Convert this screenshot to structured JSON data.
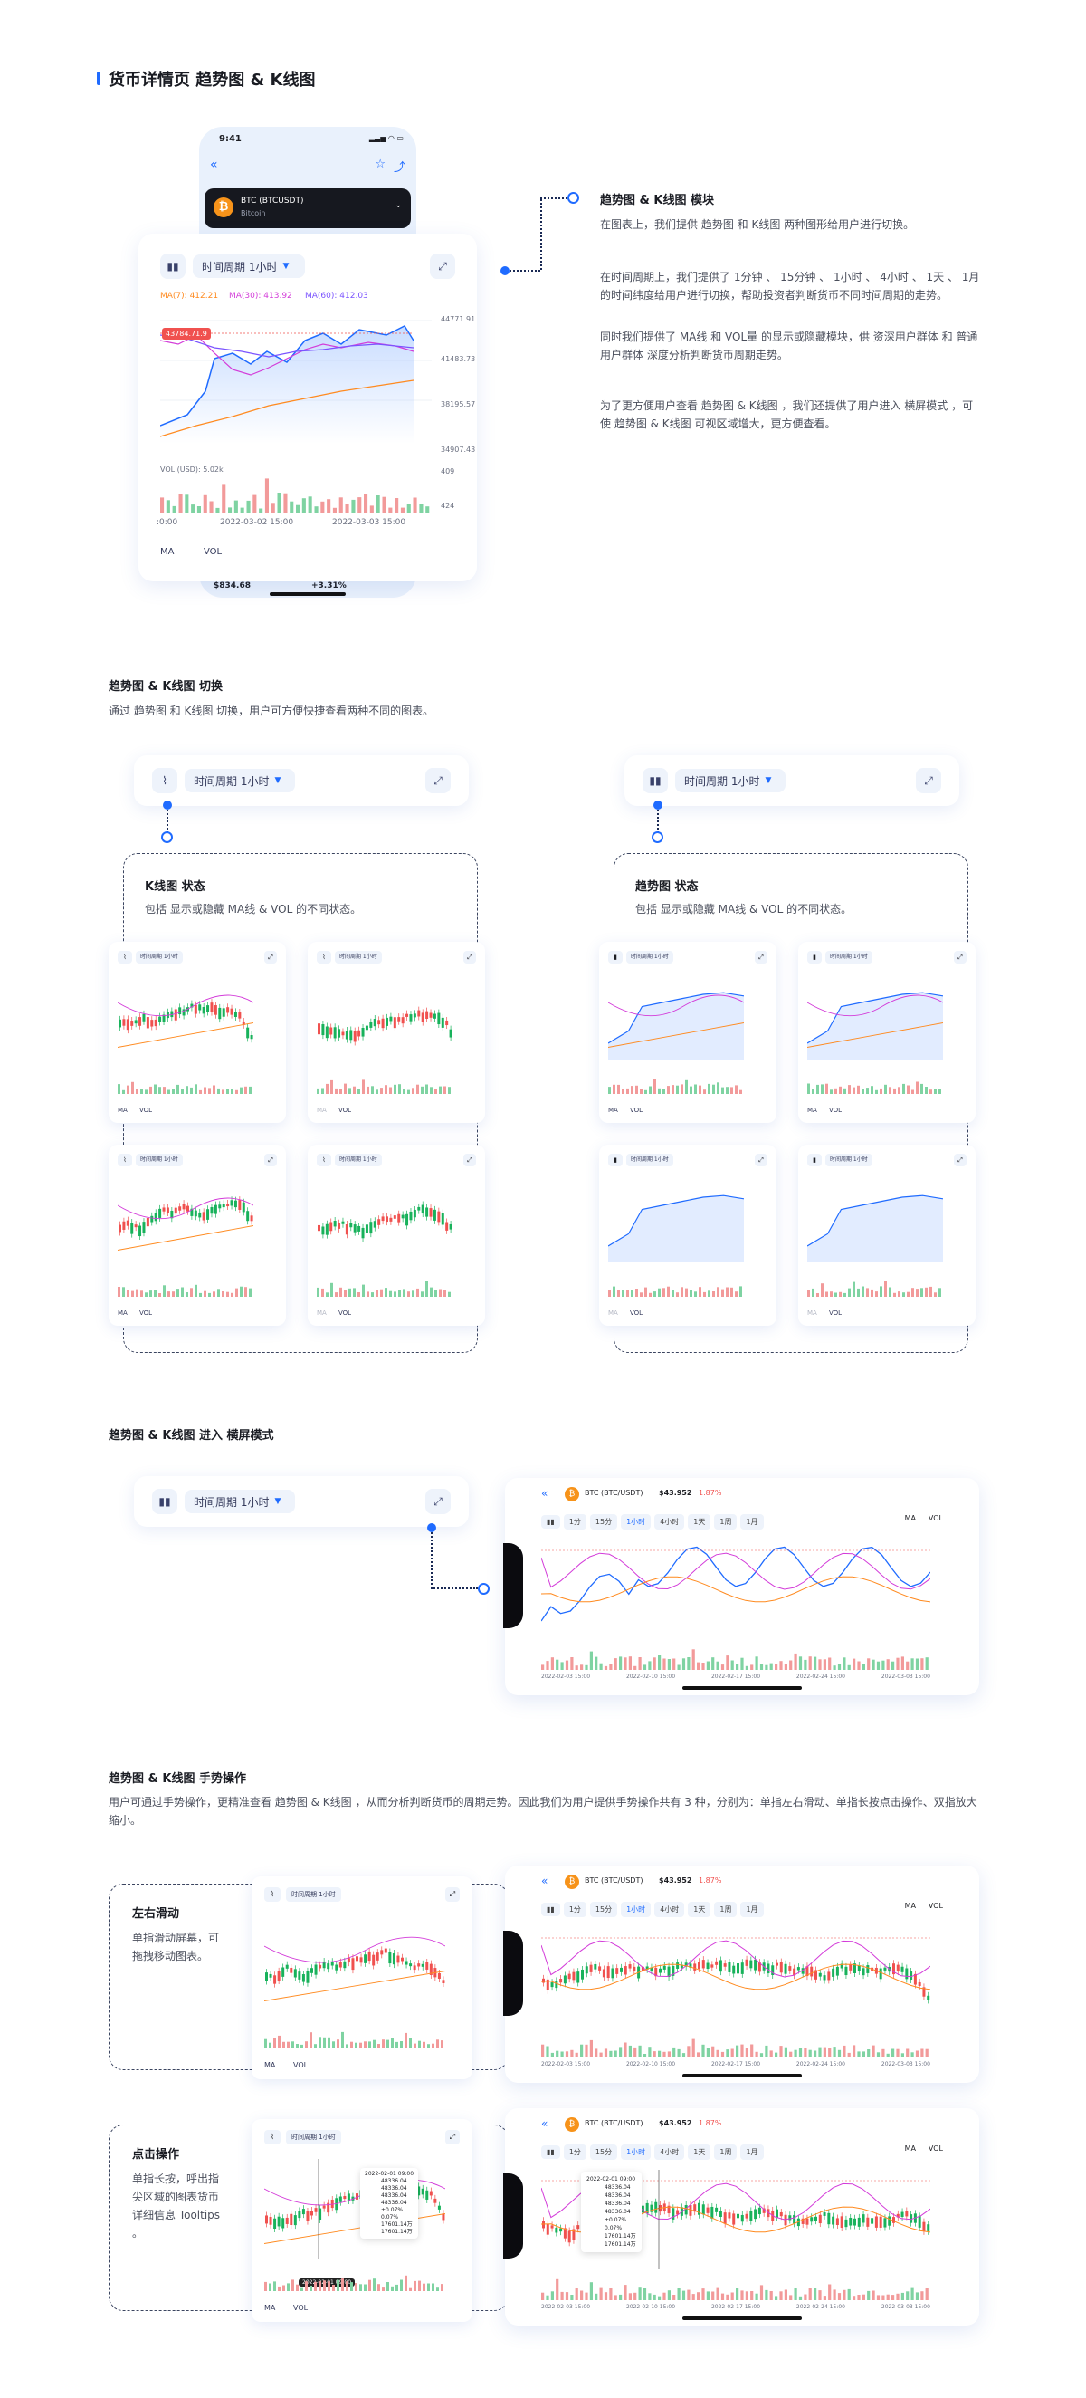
{
  "page": {
    "title": "货币详情页 趋势图 & K线图"
  },
  "phone": {
    "time": "9:41",
    "coin_name": "BTC (BTCUSDT)",
    "coin_sub": "Bitcoin",
    "bottom_left_value": "$834.68",
    "bottom_right_value": "+3.31%"
  },
  "chart_card": {
    "period_label": "时间周期 1小时",
    "ma7": "MA(7): 412.21",
    "ma30": "MA(30): 413.92",
    "ma60": "MA(60): 412.03",
    "price_tag": "43784.71.9",
    "y_ticks": [
      "44771.91",
      "41483.73",
      "38195.57",
      "34907.43"
    ],
    "vol_label": "VOL (USD): 5.02k",
    "vol_ticks": [
      "409",
      "424"
    ],
    "x_ticks": [
      ":0:00",
      "2022-03-02 15:00",
      "2022-03-03 15:00"
    ],
    "toggle_ma": "MA",
    "toggle_vol": "VOL"
  },
  "section1": {
    "title": "趋势图 & K线图 模块",
    "para1": "在图表上，我们提供 趋势图 和 K线图 两种图形给用户进行切换。",
    "para2": "在时间周期上，我们提供了 1分钟 、 15分钟 、 1小时 、 4小时 、 1天 、 1月 的时间纬度给用户进行切换，帮助投资者判断货币不同时间周期的走势。",
    "para3": "同时我们提供了 MA线 和 VOL量 的显示或隐藏模块，供 资深用户群体 和 普通用户群体 深度分析判断货币周期走势。",
    "para4": "为了更方便用户查看 趋势图 & K线图 ，我们还提供了用户进入 横屏模式 ，可使 趋势图 & K线图 可视区域增大，更方便查看。"
  },
  "section2": {
    "title": "趋势图 & K线图 切换",
    "desc": "通过 趋势图 和 K线图 切换，用户可方便快捷查看两种不同的图表。",
    "left_box_title": "K线图 状态",
    "left_box_desc": "包括 显示或隐藏 MA线 & VOL 的不同状态。",
    "right_box_title": "趋势图 状态",
    "right_box_desc": "包括 显示或隐藏 MA线 & VOL 的不同状态。",
    "period_label": "时间周期 1小时",
    "mini_period": "时间周期 1小时",
    "mini_ma": "MA",
    "mini_vol": "VOL"
  },
  "section3": {
    "title": "趋势图 & K线图 进入 横屏模式",
    "period_label": "时间周期 1小时",
    "land_coin": "BTC (BTC/USDT)",
    "land_price": "$43.952",
    "land_change": "1.87%",
    "tabs": [
      "1分",
      "15分",
      "1小时",
      "4小时",
      "1天",
      "1周",
      "1月"
    ],
    "active_tab": "1小时",
    "toggle_ma": "MA",
    "toggle_vol": "VOL",
    "x_ticks": [
      "2022-02-03 15:00",
      "2022-02-10 15:00",
      "2022-02-17 15:00",
      "2022-02-24 15:00",
      "2022-03-03 15:00"
    ]
  },
  "section4": {
    "title": "趋势图 & K线图 手势操作",
    "desc": "用户可通过手势操作，更精准查看 趋势图 & K线图 ，从而分析判断货币的周期走势。因此我们为用户提供手势操作共有 3 种，分别为：单指左右滑动、单指长按点击操作、双指放大缩小。",
    "swipe_title": "左右滑动",
    "swipe_desc": "单指滑动屏幕，可拖拽移动图表。",
    "tap_title": "点击操作",
    "tap_desc": "单指长按，呼出指尖区域的图表货币详细信息 Tooltips 。",
    "tooltip_time": "2022-02-01 09:00",
    "tooltip_rows": [
      "48336.04",
      "48336.04",
      "48336.04",
      "48336.04",
      "+0.07%",
      "0.07%",
      "17601.14万",
      "17601.14万"
    ],
    "crosshair_label": "2022-02-01 09:00"
  },
  "colors": {
    "accent": "#1f6bff",
    "up": "#18b25b",
    "down": "#f0514f",
    "ma7": "#ff8a1f",
    "ma30": "#d33bd9",
    "ma60": "#7a53ff"
  }
}
